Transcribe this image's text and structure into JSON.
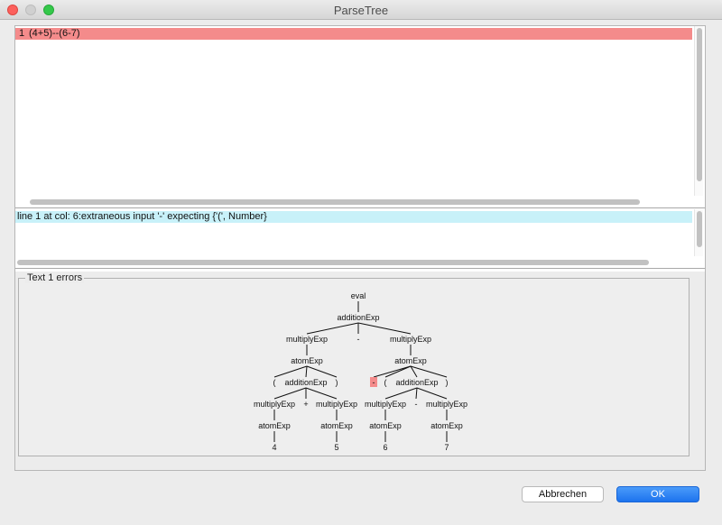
{
  "window": {
    "title": "ParseTree"
  },
  "editor": {
    "line_number": "1",
    "line_text": "(4+5)--(6-7)"
  },
  "messages": {
    "error_line": "line 1 at col: 6:extraneous input '-' expecting {'(', Number}"
  },
  "tree_panel": {
    "legend": "Text 1 errors"
  },
  "parse_tree": {
    "error_color": "#f48b8b",
    "nodes": [
      {
        "id": "eval",
        "label": "eval"
      },
      {
        "id": "add_top",
        "label": "additionExp"
      },
      {
        "id": "mul_left",
        "label": "multiplyExp"
      },
      {
        "id": "minus_top",
        "label": "-"
      },
      {
        "id": "mul_right",
        "label": "multiplyExp"
      },
      {
        "id": "atom_left",
        "label": "atomExp"
      },
      {
        "id": "atom_right",
        "label": "atomExp"
      },
      {
        "id": "lp_left",
        "label": "("
      },
      {
        "id": "add_left",
        "label": "additionExp"
      },
      {
        "id": "rp_left",
        "label": ")"
      },
      {
        "id": "err_minus",
        "label": "-",
        "error": true
      },
      {
        "id": "lp_right",
        "label": "("
      },
      {
        "id": "add_right",
        "label": "additionExp"
      },
      {
        "id": "rp_right",
        "label": ")"
      },
      {
        "id": "mul_ll",
        "label": "multiplyExp"
      },
      {
        "id": "plus",
        "label": "+"
      },
      {
        "id": "mul_lr",
        "label": "multiplyExp"
      },
      {
        "id": "mul_rl",
        "label": "multiplyExp"
      },
      {
        "id": "minus_inner",
        "label": "-"
      },
      {
        "id": "mul_rr",
        "label": "multiplyExp"
      },
      {
        "id": "atom_ll",
        "label": "atomExp"
      },
      {
        "id": "atom_lr",
        "label": "atomExp"
      },
      {
        "id": "atom_rl",
        "label": "atomExp"
      },
      {
        "id": "atom_rr",
        "label": "atomExp"
      },
      {
        "id": "n4",
        "label": "4"
      },
      {
        "id": "n5",
        "label": "5"
      },
      {
        "id": "n6",
        "label": "6"
      },
      {
        "id": "n7",
        "label": "7"
      }
    ],
    "edges": [
      [
        "eval",
        "add_top"
      ],
      [
        "add_top",
        "mul_left"
      ],
      [
        "add_top",
        "minus_top"
      ],
      [
        "add_top",
        "mul_right"
      ],
      [
        "mul_left",
        "atom_left"
      ],
      [
        "mul_right",
        "atom_right"
      ],
      [
        "atom_left",
        "lp_left"
      ],
      [
        "atom_left",
        "add_left"
      ],
      [
        "atom_left",
        "rp_left"
      ],
      [
        "atom_right",
        "err_minus"
      ],
      [
        "atom_right",
        "lp_right"
      ],
      [
        "atom_right",
        "add_right"
      ],
      [
        "atom_right",
        "rp_right"
      ],
      [
        "add_left",
        "mul_ll"
      ],
      [
        "add_left",
        "plus"
      ],
      [
        "add_left",
        "mul_lr"
      ],
      [
        "add_right",
        "mul_rl"
      ],
      [
        "add_right",
        "minus_inner"
      ],
      [
        "add_right",
        "mul_rr"
      ],
      [
        "mul_ll",
        "atom_ll"
      ],
      [
        "mul_lr",
        "atom_lr"
      ],
      [
        "mul_rl",
        "atom_rl"
      ],
      [
        "mul_rr",
        "atom_rr"
      ],
      [
        "atom_ll",
        "n4"
      ],
      [
        "atom_lr",
        "n5"
      ],
      [
        "atom_rl",
        "n6"
      ],
      [
        "atom_rr",
        "n7"
      ]
    ]
  },
  "buttons": {
    "cancel": "Abbrechen",
    "ok": "OK"
  },
  "colors": {
    "error_highlight": "#f48b8b",
    "message_highlight": "#c8f1f9",
    "ok_button": "#1d73ee"
  }
}
